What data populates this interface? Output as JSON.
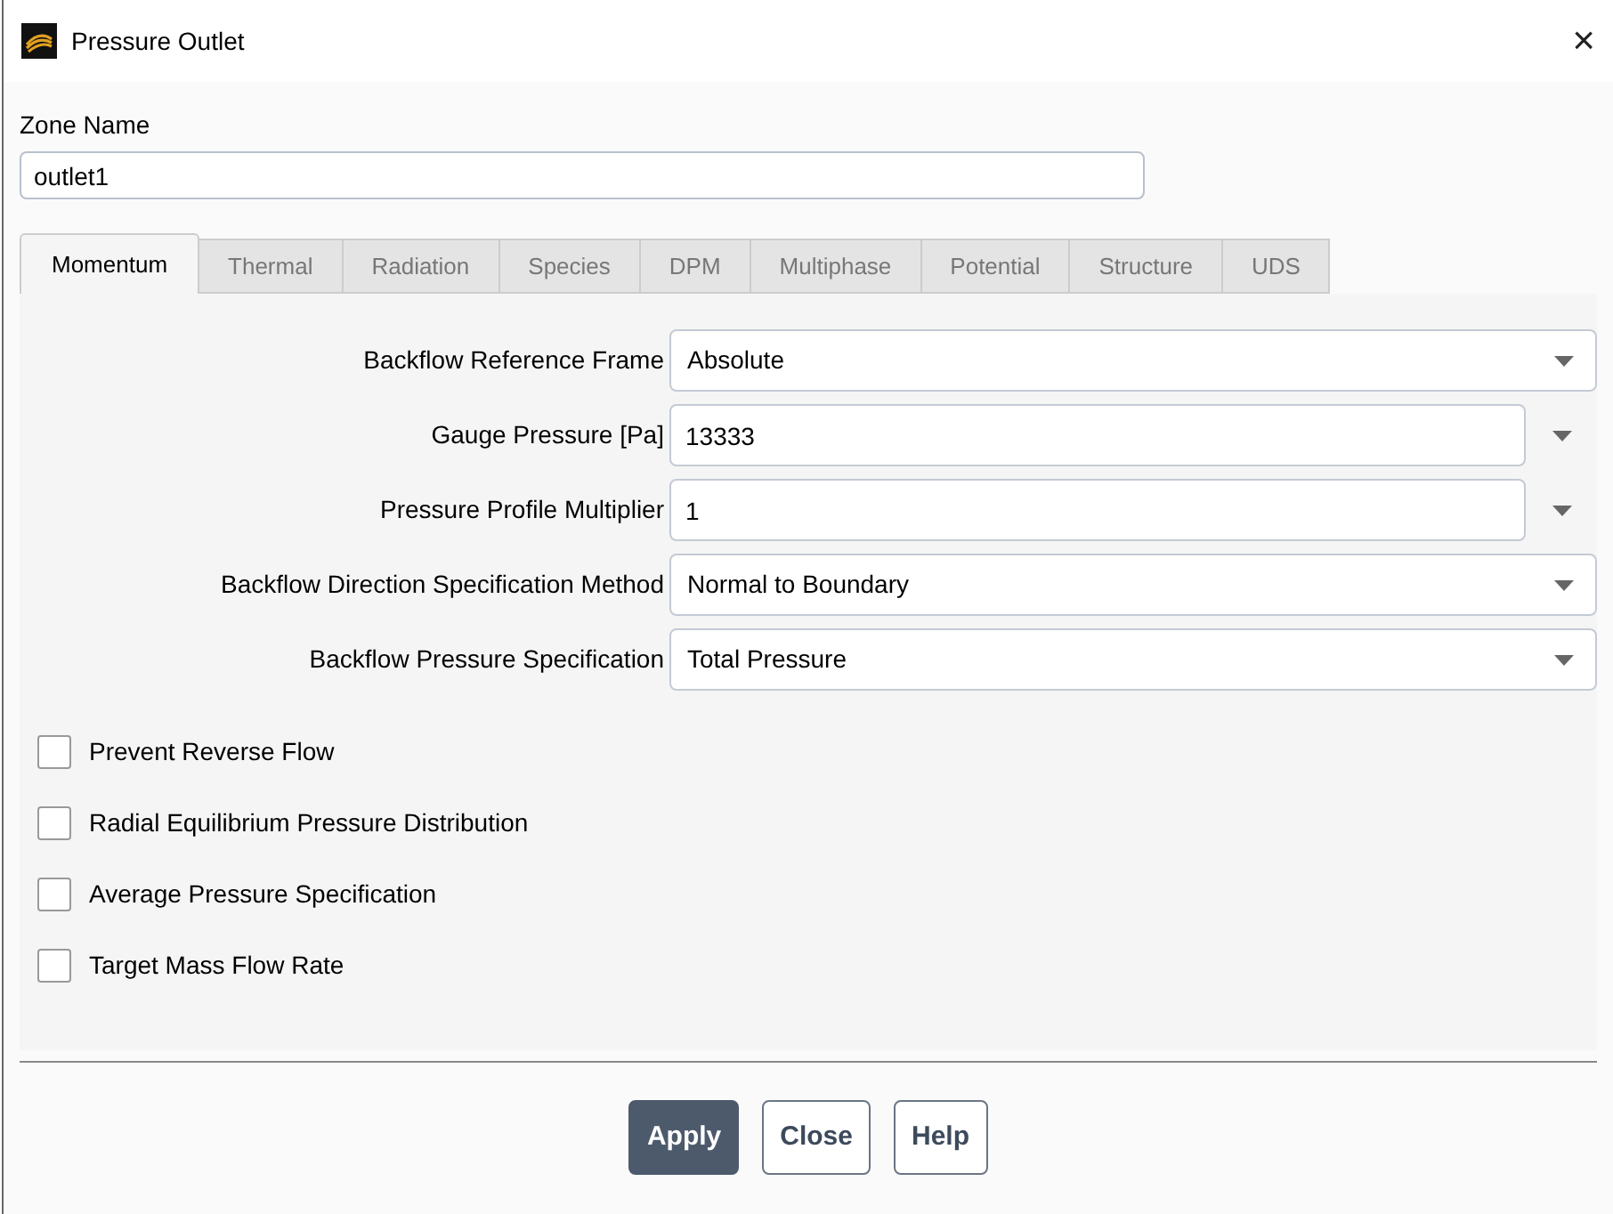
{
  "window": {
    "title": "Pressure Outlet",
    "close": "×"
  },
  "zone_name": {
    "label": "Zone Name",
    "value": "outlet1"
  },
  "tabs": [
    {
      "label": "Momentum",
      "selected": true
    },
    {
      "label": "Thermal",
      "selected": false
    },
    {
      "label": "Radiation",
      "selected": false
    },
    {
      "label": "Species",
      "selected": false
    },
    {
      "label": "DPM",
      "selected": false
    },
    {
      "label": "Multiphase",
      "selected": false
    },
    {
      "label": "Potential",
      "selected": false
    },
    {
      "label": "Structure",
      "selected": false
    },
    {
      "label": "UDS",
      "selected": false
    }
  ],
  "fields": [
    {
      "kind": "dropdown",
      "label": "Backflow Reference Frame",
      "value": "Absolute"
    },
    {
      "kind": "profile",
      "label": "Gauge Pressure [Pa]",
      "value": "13333"
    },
    {
      "kind": "profile",
      "label": "Pressure Profile Multiplier",
      "value": "1"
    },
    {
      "kind": "dropdown",
      "label": "Backflow Direction Specification Method",
      "value": "Normal to Boundary"
    },
    {
      "kind": "dropdown",
      "label": "Backflow Pressure Specification",
      "value": "Total Pressure"
    }
  ],
  "options": [
    {
      "label": "Prevent Reverse Flow",
      "checked": false
    },
    {
      "label": "Radial Equilibrium Pressure Distribution",
      "checked": false
    },
    {
      "label": "Average Pressure Specification",
      "checked": false
    },
    {
      "label": "Target Mass Flow Rate",
      "checked": false
    }
  ],
  "buttons": [
    {
      "label": "Apply",
      "primary": true
    },
    {
      "label": "Close",
      "primary": false
    },
    {
      "label": "Help",
      "primary": false
    }
  ]
}
